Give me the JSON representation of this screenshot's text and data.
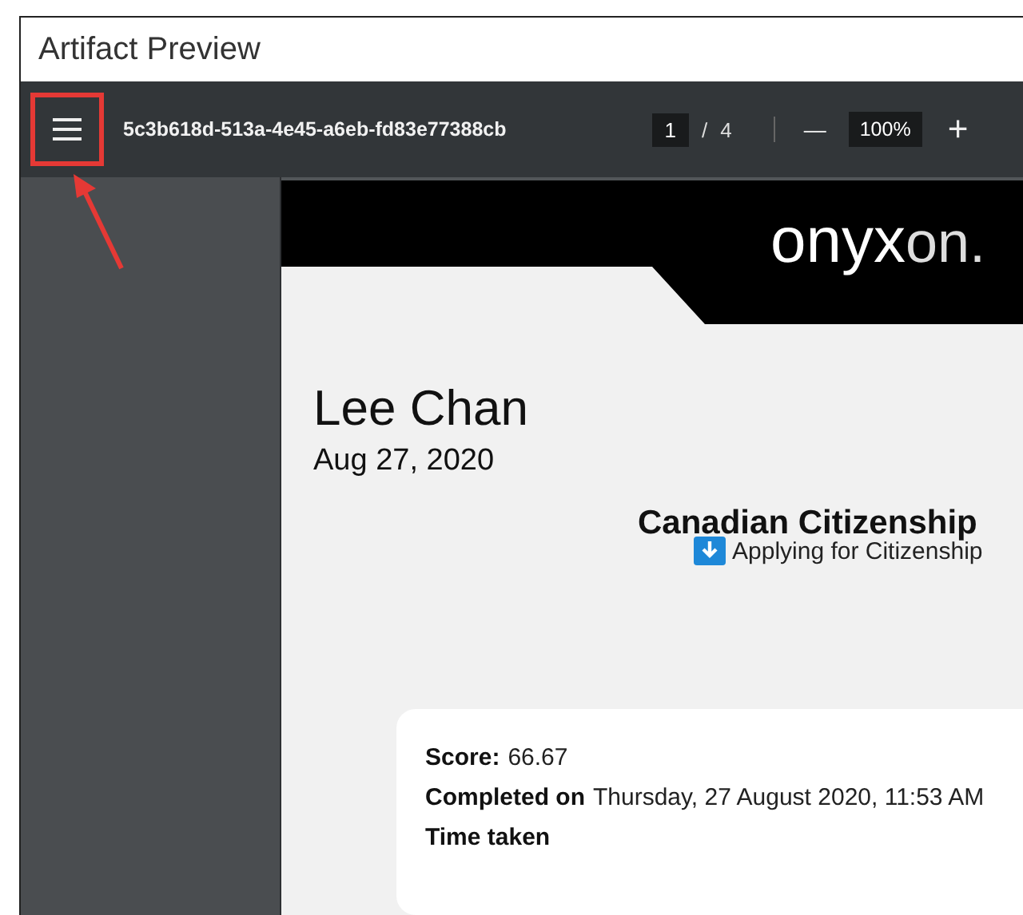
{
  "window": {
    "title": "Artifact Preview"
  },
  "toolbar": {
    "file_name": "5c3b618d-513a-4e45-a6eb-fd83e77388cb",
    "page": "1",
    "separator": "/",
    "page_count": "4",
    "zoom_out": "—",
    "zoom": "100%",
    "zoom_in": "+"
  },
  "document": {
    "logo_main": "onyx",
    "logo_suffix": "on.",
    "name": "Lee Chan",
    "date": "Aug 27, 2020",
    "title": "Canadian Citizenship",
    "subtitle": "Applying for Citizenship",
    "details": [
      {
        "label": "Score:",
        "value": "66.67"
      },
      {
        "label": "Completed on",
        "value": "Thursday, 27 August 2020, 11:53 AM"
      },
      {
        "label": "Time taken"
      }
    ]
  }
}
